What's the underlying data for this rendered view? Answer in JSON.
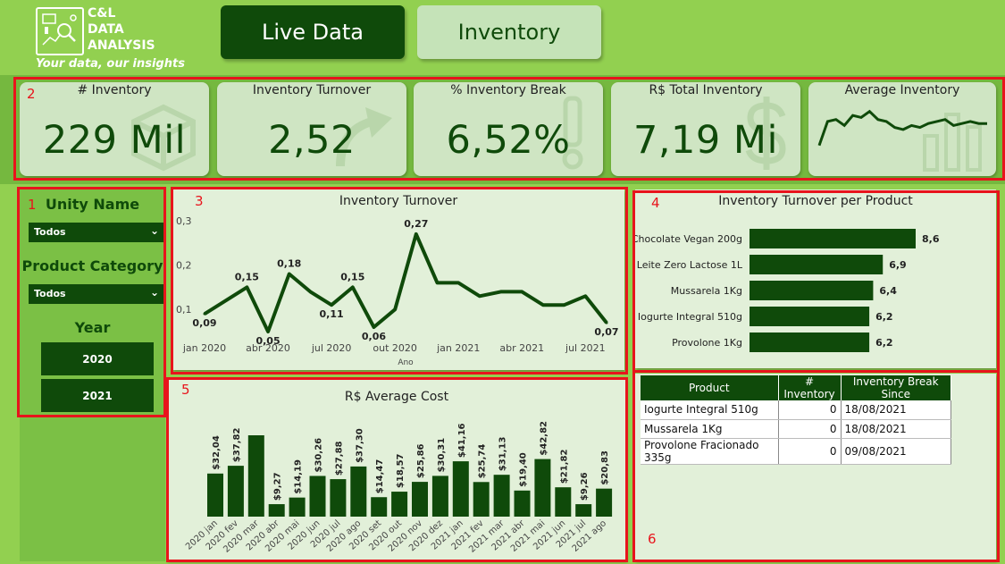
{
  "logo": {
    "name_line1": "C&L",
    "name_line2": "DATA",
    "name_line3": "ANALYSIS",
    "tagline": "Your data, our insights"
  },
  "nav": {
    "live_label": "Live Data",
    "inventory_label": "Inventory"
  },
  "section_numbers": {
    "s1": "1",
    "s2": "2",
    "s3": "3",
    "s4": "4",
    "s5": "5",
    "s6": "6"
  },
  "kpis": [
    {
      "title": "# Inventory",
      "value": "229 Mil",
      "icon": "box-icon"
    },
    {
      "title": "Inventory Turnover",
      "value": "2,52",
      "icon": "arrow-icon"
    },
    {
      "title": "% Inventory Break",
      "value": "6,52%",
      "icon": "exclamation-icon"
    },
    {
      "title": "R$ Total Inventory",
      "value": "7,19 Mi",
      "icon": "dollar-icon"
    },
    {
      "title": "Average Inventory",
      "icon": "bars-icon"
    }
  ],
  "slicers": {
    "unity_label": "Unity Name",
    "unity_value": "Todos",
    "category_label": "Product Category",
    "category_value": "Todos",
    "year_label": "Year",
    "years": [
      "2020",
      "2021"
    ]
  },
  "colors": {
    "accent": "#0f4a0a",
    "background": "#92d050",
    "panel": "#e2f0d9",
    "highlight": "#e8141c"
  },
  "chart_data": [
    {
      "id": "average_inventory_sparkline",
      "type": "line",
      "title": "Average Inventory",
      "values": [
        60,
        72,
        73,
        70,
        75,
        74,
        77,
        73,
        72,
        69,
        68,
        70,
        69,
        71,
        72,
        73,
        70,
        71,
        72,
        71,
        71
      ]
    },
    {
      "id": "inventory_turnover",
      "type": "line",
      "title": "Inventory Turnover",
      "xlabel": "Ano",
      "x": [
        "jan 2020",
        "fev 2020",
        "mar 2020",
        "abr 2020",
        "mai 2020",
        "jun 2020",
        "jul 2020",
        "ago 2020",
        "set 2020",
        "out 2020",
        "nov 2020",
        "dez 2020",
        "jan 2021",
        "fev 2021",
        "mar 2021",
        "abr 2021",
        "mai 2021",
        "jun 2021",
        "jul 2021",
        "ago 2021"
      ],
      "values": [
        0.09,
        0.12,
        0.15,
        0.05,
        0.18,
        0.14,
        0.11,
        0.15,
        0.06,
        0.1,
        0.27,
        0.16,
        0.16,
        0.13,
        0.14,
        0.14,
        0.11,
        0.11,
        0.13,
        0.07
      ],
      "point_labels": [
        "0,09",
        "",
        "0,15",
        "0,05",
        "0,18",
        "",
        "0,11",
        "0,15",
        "0,06",
        "",
        "0,27",
        "",
        "",
        "",
        "",
        "",
        "",
        "",
        "",
        "0,07"
      ],
      "x_tick_labels": [
        "jan 2020",
        "abr 2020",
        "jul 2020",
        "out 2020",
        "jan 2021",
        "abr 2021",
        "jul 2021"
      ],
      "y_ticks": [
        "0,1",
        "0,2",
        "0,3"
      ],
      "ylim": [
        0.05,
        0.3
      ]
    },
    {
      "id": "turnover_per_product",
      "type": "bar",
      "title": "Inventory Turnover per Product",
      "categories": [
        "Chocolate Vegan 200g",
        "Leite Zero Lactose 1L",
        "Mussarela 1Kg",
        "Iogurte Integral 510g",
        "Provolone 1Kg"
      ],
      "values": [
        8.6,
        6.9,
        6.4,
        6.2,
        6.2
      ],
      "value_labels": [
        "8,6",
        "6,9",
        "6,4",
        "6,2",
        "6,2"
      ]
    },
    {
      "id": "average_cost",
      "type": "bar",
      "title": "R$ Average Cost",
      "categories": [
        "2020 jan",
        "2020 fev",
        "2020 mar",
        "2020 abr",
        "2020 mai",
        "2020 jun",
        "2020 jul",
        "2020 ago",
        "2020 set",
        "2020 out",
        "2020 nov",
        "2020 dez",
        "2021 jan",
        "2021 fev",
        "2021 mar",
        "2021 abr",
        "2021 mai",
        "2021 jun",
        "2021 jul",
        "2021 ago"
      ],
      "values": [
        32.04,
        37.82,
        60.5,
        9.27,
        14.19,
        30.26,
        27.88,
        37.3,
        14.47,
        18.57,
        25.86,
        30.31,
        41.16,
        25.74,
        31.13,
        19.4,
        42.82,
        21.82,
        9.26,
        20.83
      ],
      "value_labels": [
        "$32,04",
        "$37,82",
        "",
        "$9,27",
        "$14,19",
        "$30,26",
        "$27,88",
        "$37,30",
        "$14,47",
        "$18,57",
        "$25,86",
        "$30,31",
        "$41,16",
        "$25,74",
        "$31,13",
        "$19,40",
        "$42,82",
        "$21,82",
        "$9,26",
        "$20,83"
      ]
    }
  ],
  "table": {
    "headers": [
      "Product",
      "# Inventory",
      "Inventory Break Since"
    ],
    "rows": [
      [
        "Iogurte Integral 510g",
        "0",
        "18/08/2021"
      ],
      [
        "Mussarela 1Kg",
        "0",
        "18/08/2021"
      ],
      [
        "Provolone Fracionado 335g",
        "0",
        "09/08/2021"
      ]
    ]
  }
}
